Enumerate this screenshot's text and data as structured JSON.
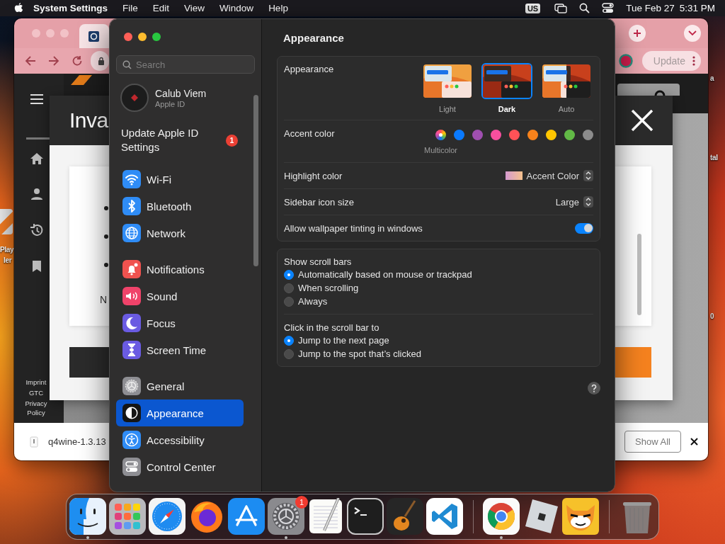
{
  "menu_bar": {
    "app_name": "System Settings",
    "menus": [
      "File",
      "Edit",
      "View",
      "Window",
      "Help"
    ],
    "input_source": "US",
    "date": "Tue Feb 27",
    "time": "5:31 PM"
  },
  "desktop": {
    "left_labels": [
      "Play",
      "ler"
    ],
    "right_labels": [
      "a",
      "tal",
      "0"
    ]
  },
  "browser": {
    "update_button": "Update",
    "dialog_title": "Inva",
    "dialog_text": "N",
    "footer_links": [
      "Imprint",
      "GTC",
      "Privacy Policy"
    ],
    "download_file": "q4wine-1.3.13",
    "show_all_button": "Show All"
  },
  "settings": {
    "search": {
      "placeholder": "Search"
    },
    "account": {
      "name": "Calub Viem",
      "subtitle": "Apple ID"
    },
    "update_notice": {
      "label": "Update Apple ID Settings",
      "badge": "1"
    },
    "sidebar_groups": [
      [
        {
          "label": "Wi-Fi",
          "kind": "wifi",
          "selected": false
        },
        {
          "label": "Bluetooth",
          "kind": "bluetooth",
          "selected": false
        },
        {
          "label": "Network",
          "kind": "network",
          "selected": false
        }
      ],
      [
        {
          "label": "Notifications",
          "kind": "notifications",
          "selected": false
        },
        {
          "label": "Sound",
          "kind": "sound",
          "selected": false
        },
        {
          "label": "Focus",
          "kind": "focus",
          "selected": false
        },
        {
          "label": "Screen Time",
          "kind": "screen_time",
          "selected": false
        }
      ],
      [
        {
          "label": "General",
          "kind": "general",
          "selected": false
        },
        {
          "label": "Appearance",
          "kind": "appearance",
          "selected": true
        },
        {
          "label": "Accessibility",
          "kind": "accessibility",
          "selected": false
        },
        {
          "label": "Control Center",
          "kind": "control_center",
          "selected": false
        }
      ]
    ],
    "title": "Appearance",
    "appearance": {
      "label": "Appearance",
      "options": [
        {
          "label": "Light",
          "kind": "light",
          "selected": false
        },
        {
          "label": "Dark",
          "kind": "dark",
          "selected": true
        },
        {
          "label": "Auto",
          "kind": "auto",
          "selected": false
        }
      ]
    },
    "accent_color": {
      "label": "Accent color",
      "caption": "Multicolor",
      "colors": [
        {
          "kind": "multicolor",
          "selected": true
        },
        {
          "kind": "solid",
          "color": "#0a7aff",
          "selected": false
        },
        {
          "kind": "solid",
          "color": "#9f4fb0",
          "selected": false
        },
        {
          "kind": "solid",
          "color": "#f74f9e",
          "selected": false
        },
        {
          "kind": "solid",
          "color": "#ff5257",
          "selected": false
        },
        {
          "kind": "solid",
          "color": "#f7821b",
          "selected": false
        },
        {
          "kind": "solid",
          "color": "#ffc600",
          "selected": false
        },
        {
          "kind": "solid",
          "color": "#62ba46",
          "selected": false
        },
        {
          "kind": "solid",
          "color": "#8c8c8c",
          "selected": false
        }
      ]
    },
    "highlight_color": {
      "label": "Highlight color",
      "value": "Accent Color"
    },
    "sidebar_icon_size": {
      "label": "Sidebar icon size",
      "value": "Large"
    },
    "wallpaper_tinting": {
      "label": "Allow wallpaper tinting in windows",
      "on": true
    },
    "show_scroll_bars": {
      "label": "Show scroll bars",
      "options": [
        {
          "label": "Automatically based on mouse or trackpad",
          "selected": true
        },
        {
          "label": "When scrolling",
          "selected": false
        },
        {
          "label": "Always",
          "selected": false
        }
      ]
    },
    "click_scroll_bar": {
      "label": "Click in the scroll bar to",
      "options": [
        {
          "label": "Jump to the next page",
          "selected": true
        },
        {
          "label": "Jump to the spot that’s clicked",
          "selected": false
        }
      ]
    }
  },
  "dock": {
    "sections": [
      [
        {
          "kind": "finder",
          "running": true
        },
        {
          "kind": "launchpad",
          "running": false
        },
        {
          "kind": "safari",
          "running": false
        },
        {
          "kind": "firefox",
          "running": false
        },
        {
          "kind": "app_store",
          "running": false
        },
        {
          "kind": "system_settings",
          "running": true,
          "badge": "1"
        },
        {
          "kind": "textedit",
          "running": false
        },
        {
          "kind": "terminal",
          "running": false
        },
        {
          "kind": "garageband",
          "running": false
        },
        {
          "kind": "vscode",
          "running": false
        }
      ],
      [
        {
          "kind": "chrome",
          "running": true
        },
        {
          "kind": "roblox",
          "running": false
        },
        {
          "kind": "game",
          "running": false
        }
      ],
      [
        {
          "kind": "trash",
          "running": false
        }
      ]
    ]
  }
}
